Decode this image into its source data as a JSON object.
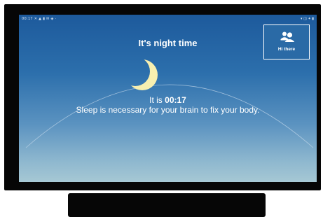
{
  "status_bar": {
    "left_text": "00:17  ✕  ▲ ▮ ✉ ◈  ·",
    "right_text": "▾ ◫ ✦ ▮"
  },
  "screen": {
    "title": "It's night time",
    "time_prefix": "It is ",
    "time_value": "00:17",
    "message": "Sleep is necessary for your brain to fix your body."
  },
  "profile": {
    "label": "Hi there",
    "icon": "users-icon"
  },
  "icons": {
    "moon": "moon-icon"
  },
  "colors": {
    "sky_top": "#1d5a9c",
    "sky_bottom": "#a6c8d4",
    "moon": "#f7efb0",
    "text": "#ffffff",
    "device_frame": "#060606"
  }
}
